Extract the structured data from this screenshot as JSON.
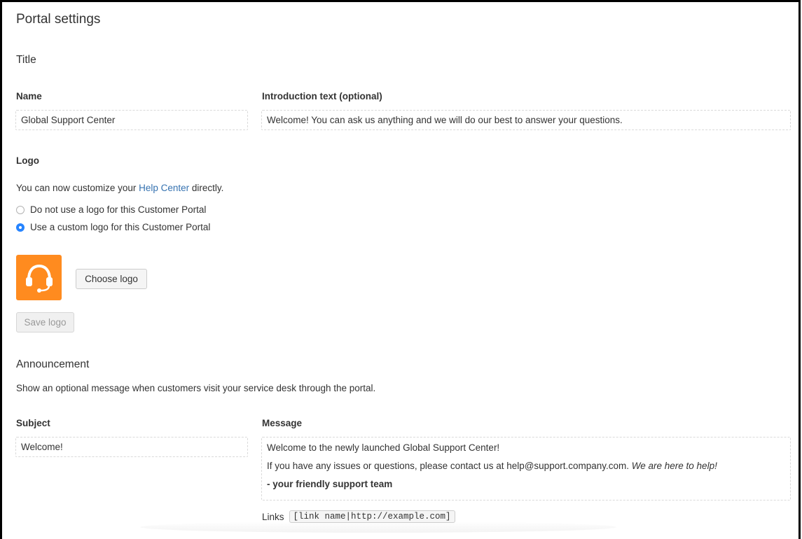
{
  "page": {
    "title": "Portal settings"
  },
  "title_section": {
    "heading": "Title",
    "name_label": "Name",
    "name_value": "Global Support Center",
    "intro_label": "Introduction text (optional)",
    "intro_value": "Welcome! You can ask us anything and we will do our best to answer your questions."
  },
  "logo_section": {
    "heading": "Logo",
    "customize_prefix": "You can now customize your ",
    "customize_link": "Help Center",
    "customize_suffix": " directly.",
    "options": [
      {
        "label": "Do not use a logo for this Customer Portal",
        "checked": false
      },
      {
        "label": "Use a custom logo for this Customer Portal",
        "checked": true
      }
    ],
    "logo_icon": "headset-icon",
    "logo_color": "#ff8b1f",
    "choose_button": "Choose logo",
    "save_button": "Save logo"
  },
  "announcement": {
    "heading": "Announcement",
    "description": "Show an optional message when customers visit your service desk through the portal.",
    "subject_label": "Subject",
    "subject_value": "Welcome!",
    "message_label": "Message",
    "message_line1": "Welcome to the newly launched Global Support Center!",
    "message_line2_text": "If you have any issues or questions, please contact us at help@support.company.com. ",
    "message_line2_italic": "We are here to help!",
    "message_line3": "- your friendly support team",
    "links_label": "Links",
    "links_example": "[link name|http://example.com]"
  },
  "colors": {
    "accent": "#3572b0",
    "radio_checked": "#2684ff"
  }
}
